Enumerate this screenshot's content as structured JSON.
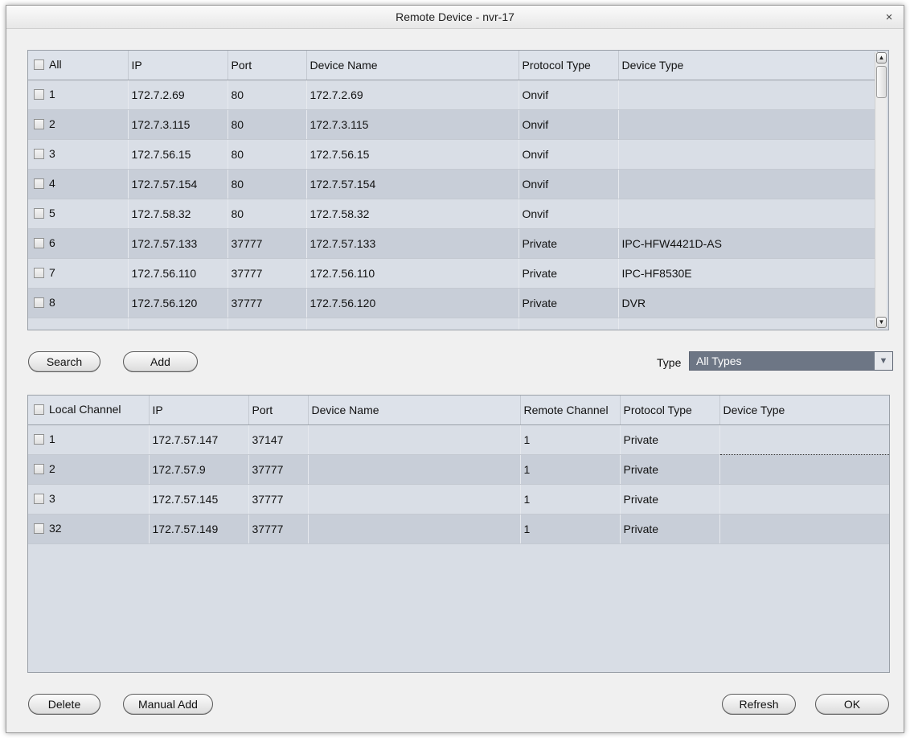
{
  "window": {
    "title": "Remote Device - nvr-17",
    "close_glyph": "×"
  },
  "remote_table": {
    "columns": [
      "All",
      "IP",
      "Port",
      "Device Name",
      "Protocol Type",
      "Device Type"
    ],
    "rows": [
      {
        "no": "1",
        "ip": "172.7.2.69",
        "port": "80",
        "name": "172.7.2.69",
        "protocol": "Onvif",
        "type": ""
      },
      {
        "no": "2",
        "ip": "172.7.3.115",
        "port": "80",
        "name": "172.7.3.115",
        "protocol": "Onvif",
        "type": ""
      },
      {
        "no": "3",
        "ip": "172.7.56.15",
        "port": "80",
        "name": "172.7.56.15",
        "protocol": "Onvif",
        "type": ""
      },
      {
        "no": "4",
        "ip": "172.7.57.154",
        "port": "80",
        "name": "172.7.57.154",
        "protocol": "Onvif",
        "type": ""
      },
      {
        "no": "5",
        "ip": "172.7.58.32",
        "port": "80",
        "name": "172.7.58.32",
        "protocol": "Onvif",
        "type": ""
      },
      {
        "no": "6",
        "ip": "172.7.57.133",
        "port": "37777",
        "name": "172.7.57.133",
        "protocol": "Private",
        "type": "IPC-HFW4421D-AS"
      },
      {
        "no": "7",
        "ip": "172.7.56.110",
        "port": "37777",
        "name": "172.7.56.110",
        "protocol": "Private",
        "type": "IPC-HF8530E"
      },
      {
        "no": "8",
        "ip": "172.7.56.120",
        "port": "37777",
        "name": "172.7.56.120",
        "protocol": "Private",
        "type": "DVR"
      }
    ]
  },
  "actions": {
    "search_label": "Search",
    "add_label": "Add"
  },
  "filter": {
    "label": "Type",
    "selected": "All Types",
    "arrow_icon": "chevron-down-icon"
  },
  "added_table": {
    "columns": [
      "Local Channel",
      "IP",
      "Port",
      "Device Name",
      "Remote Channel",
      "Protocol Type",
      "Device Type"
    ],
    "rows": [
      {
        "ch": "1",
        "ip": "172.7.57.147",
        "port": "37147",
        "name": "",
        "remote": "1",
        "protocol": "Private",
        "type": ""
      },
      {
        "ch": "2",
        "ip": "172.7.57.9",
        "port": "37777",
        "name": "",
        "remote": "1",
        "protocol": "Private",
        "type": ""
      },
      {
        "ch": "3",
        "ip": "172.7.57.145",
        "port": "37777",
        "name": "",
        "remote": "1",
        "protocol": "Private",
        "type": ""
      },
      {
        "ch": "32",
        "ip": "172.7.57.149",
        "port": "37777",
        "name": "",
        "remote": "1",
        "protocol": "Private",
        "type": ""
      }
    ]
  },
  "footer": {
    "delete_label": "Delete",
    "manual_add_label": "Manual Add",
    "refresh_label": "Refresh",
    "ok_label": "OK"
  },
  "colors": {
    "grid_row_a": "#d9dee6",
    "grid_row_b": "#c8ced8",
    "select_bg": "#6d7685"
  }
}
